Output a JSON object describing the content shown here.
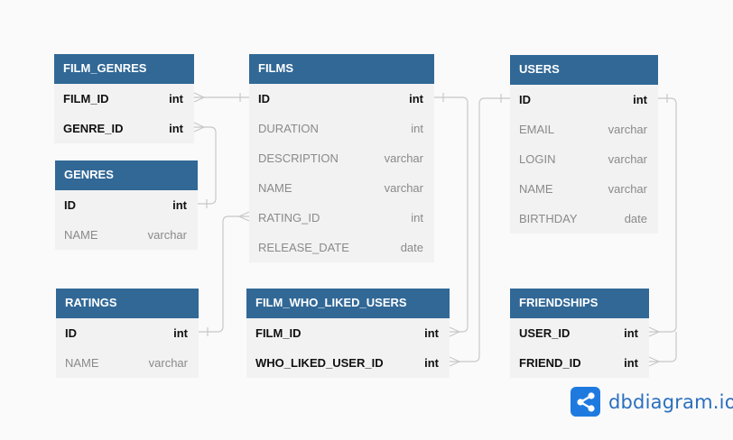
{
  "tables": {
    "film_genres": {
      "name": "FILM_GENRES",
      "columns": [
        {
          "name": "FILM_ID",
          "type": "int",
          "key": true
        },
        {
          "name": "GENRE_ID",
          "type": "int",
          "key": true
        }
      ]
    },
    "genres": {
      "name": "GENRES",
      "columns": [
        {
          "name": "ID",
          "type": "int",
          "key": true
        },
        {
          "name": "NAME",
          "type": "varchar",
          "key": false
        }
      ]
    },
    "films": {
      "name": "FILMS",
      "columns": [
        {
          "name": "ID",
          "type": "int",
          "key": true
        },
        {
          "name": "DURATION",
          "type": "int",
          "key": false
        },
        {
          "name": "DESCRIPTION",
          "type": "varchar",
          "key": false
        },
        {
          "name": "NAME",
          "type": "varchar",
          "key": false
        },
        {
          "name": "RATING_ID",
          "type": "int",
          "key": false
        },
        {
          "name": "RELEASE_DATE",
          "type": "date",
          "key": false
        }
      ]
    },
    "users": {
      "name": "USERS",
      "columns": [
        {
          "name": "ID",
          "type": "int",
          "key": true
        },
        {
          "name": "EMAIL",
          "type": "varchar",
          "key": false
        },
        {
          "name": "LOGIN",
          "type": "varchar",
          "key": false
        },
        {
          "name": "NAME",
          "type": "varchar",
          "key": false
        },
        {
          "name": "BIRTHDAY",
          "type": "date",
          "key": false
        }
      ]
    },
    "ratings": {
      "name": "RATINGS",
      "columns": [
        {
          "name": "ID",
          "type": "int",
          "key": true
        },
        {
          "name": "NAME",
          "type": "varchar",
          "key": false
        }
      ]
    },
    "film_who_liked_users": {
      "name": "FILM_WHO_LIKED_USERS",
      "columns": [
        {
          "name": "FILM_ID",
          "type": "int",
          "key": true
        },
        {
          "name": "WHO_LIKED_USER_ID",
          "type": "int",
          "key": true
        }
      ]
    },
    "friendships": {
      "name": "FRIENDSHIPS",
      "columns": [
        {
          "name": "USER_ID",
          "type": "int",
          "key": true
        },
        {
          "name": "FRIEND_ID",
          "type": "int",
          "key": true
        }
      ]
    }
  },
  "logo": {
    "text": "dbdiagram.io",
    "icon": "share-nodes-icon"
  },
  "colors": {
    "header": "#316896",
    "body": "#f2f2f2",
    "line": "#c8c8c8",
    "brand": "#1f7ae0"
  }
}
